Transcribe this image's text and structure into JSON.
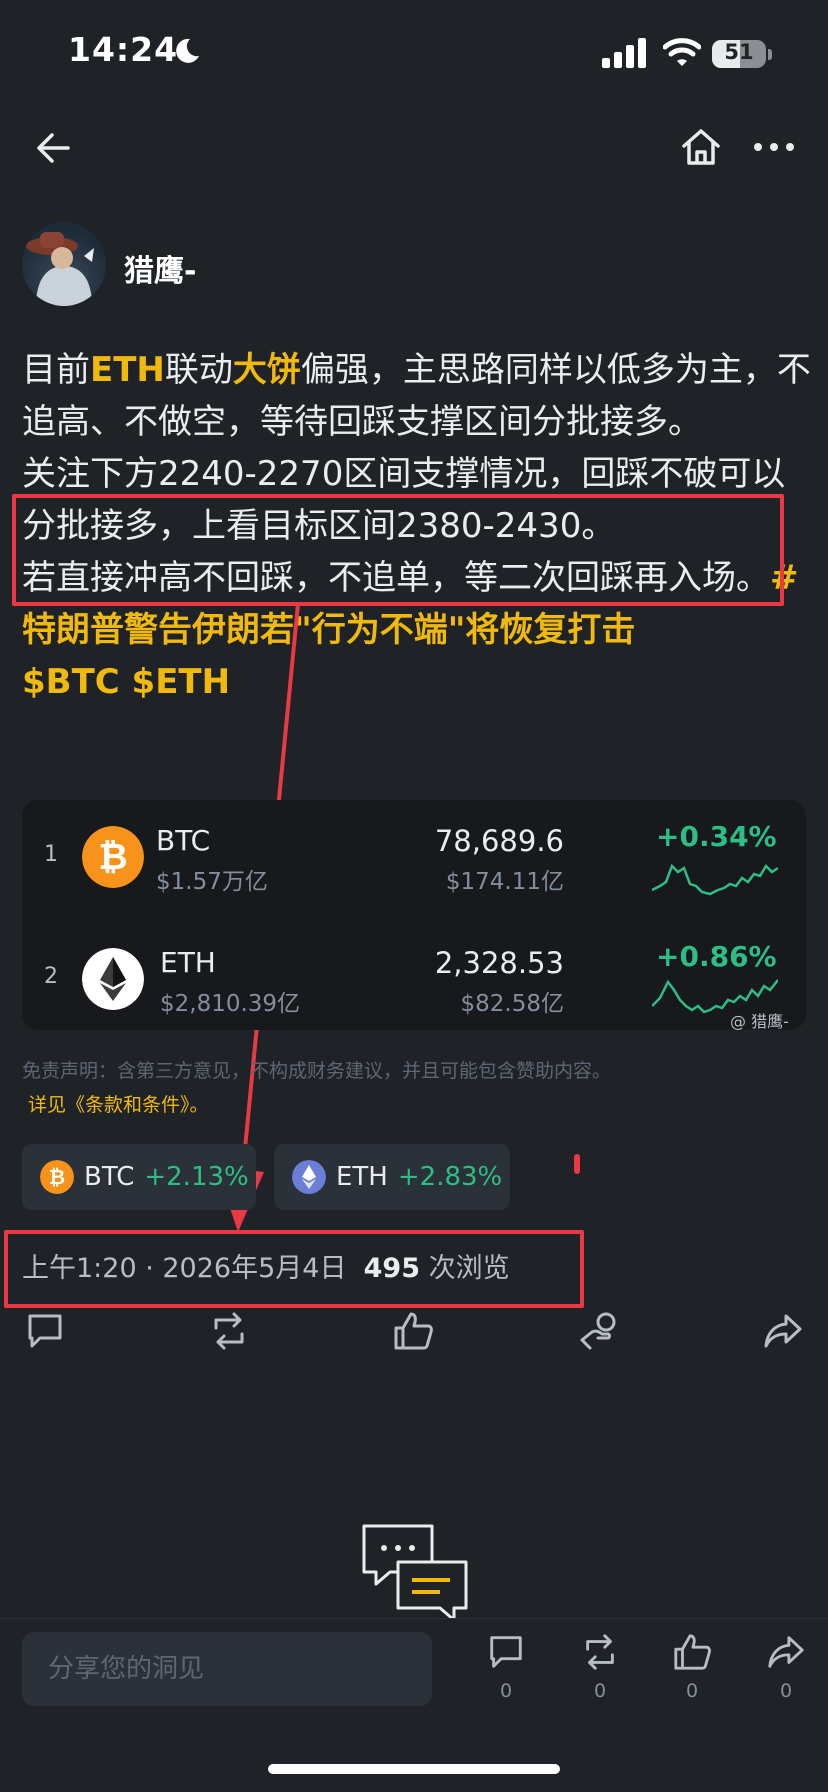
{
  "status_bar": {
    "time": "14:24",
    "battery": "51",
    "battery_level": 0.51
  },
  "author": {
    "name": "猎鹰-"
  },
  "post": {
    "p1": {
      "a": "目前",
      "b": "ETH",
      "c": "联动",
      "d": "大饼",
      "e": "偏强，主思路同样以低多为主，不追高、不做空，等待回踩支撑区间分批接多。"
    },
    "p2": "关注下方2240-2270区间支撑情况，回踩不破可以分批接多，上看目标区间2380-2430。",
    "p3": {
      "a": "若直接冲高不回踩，不追单，等二次回踩再入场。",
      "tag": "#特朗普警告伊朗若\"行为不端\"将恢复打击"
    },
    "p4": "$BTC $ETH"
  },
  "coins": [
    {
      "rank": "1",
      "symbol": "BTC",
      "market_cap": "$1.57万亿",
      "price": "78,689.6",
      "volume": "$174.11亿",
      "change": "+0.34%",
      "icon": "bitcoin-icon",
      "color": "#f7931a"
    },
    {
      "rank": "2",
      "symbol": "ETH",
      "market_cap": "$2,810.39亿",
      "price": "2,328.53",
      "volume": "$82.58亿",
      "change": "+0.86%",
      "icon": "ethereum-icon",
      "color": "#ffffff"
    }
  ],
  "watermark": "@ 猎鹰-",
  "disclaimer": "免责声明：含第三方意见，不构成财务建议，并且可能包含赞助内容。",
  "terms": "详见《条款和条件》。",
  "chips": [
    {
      "symbol": "BTC",
      "change": "+2.13%"
    },
    {
      "symbol": "ETH",
      "change": "+2.83%"
    }
  ],
  "meta": {
    "time": "上午1:20 · 2026年5月4日",
    "views": "495",
    "views_label": "次浏览"
  },
  "bottom_bar": {
    "placeholder": "分享您的洞见",
    "comment_count": "0",
    "repost_count": "0",
    "like_count": "0",
    "share_count": "0"
  },
  "colors": {
    "background": "#1f2328",
    "accent": "#f0b90b",
    "positive": "#2ebd85",
    "annotation": "#ea3943"
  }
}
